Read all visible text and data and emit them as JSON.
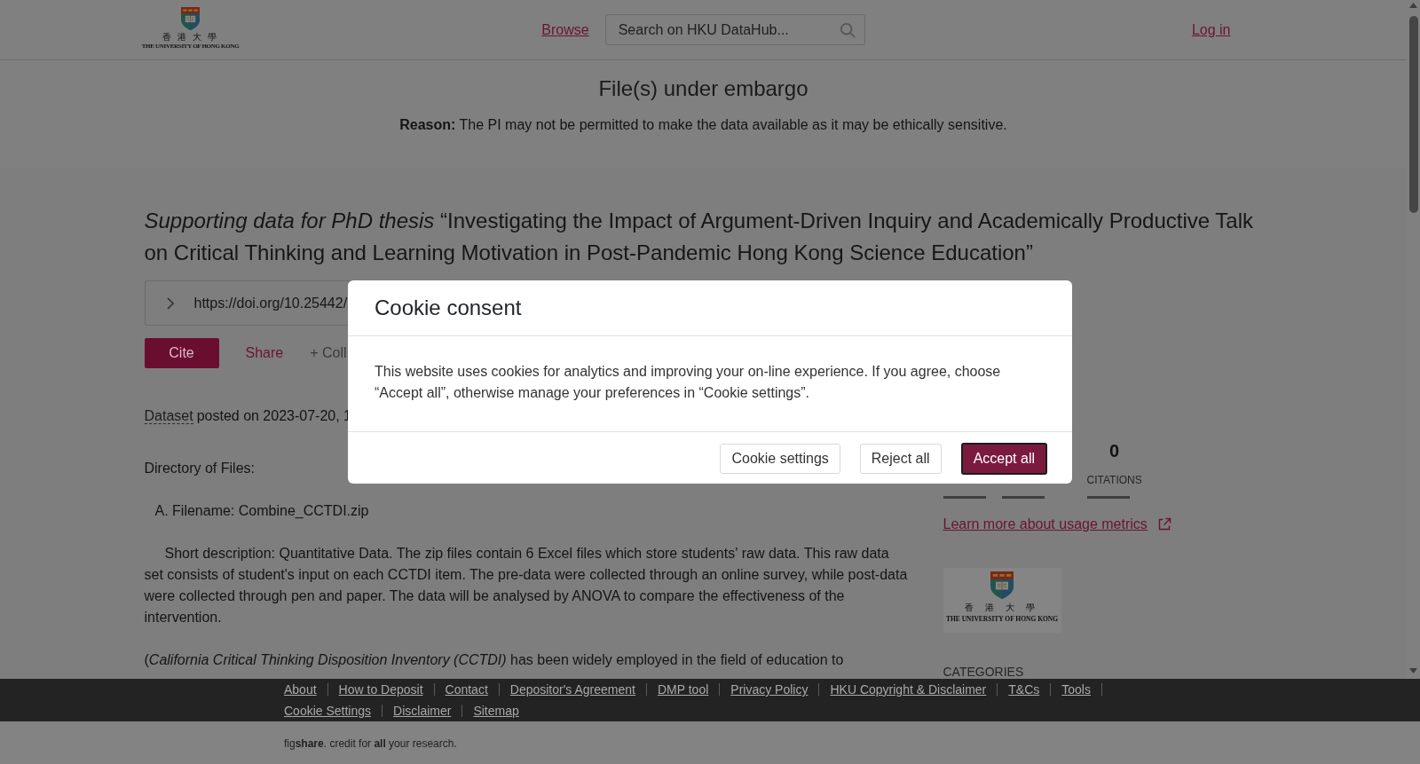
{
  "header": {
    "logo": {
      "chinese": "香 港 大 學",
      "english": "THE UNIVERSITY OF HONG KONG"
    },
    "browse_link": "Browse",
    "search": {
      "placeholder": "Search on HKU DataHub..."
    },
    "login_link": "Log in"
  },
  "embargo": {
    "title": "File(s) under embargo",
    "reason": "**Reason:** The PI may not be permitted to make the data available as it may be ethically sensitive."
  },
  "dataset": {
    "title": "*Supporting data for PhD thesis* “Investigating the Impact of Argument-Driven Inquiry and Academically Productive Talk on Critical Thinking and Learning Motivation in Post-Pandemic Hong Kong Science Education”",
    "doi": "https://doi.org/10.25442/",
    "actions": [
      {
        "kind": "primary",
        "label": "Cite"
      },
      {
        "kind": "link",
        "label": "Share"
      },
      {
        "kind": "muted",
        "label": "+ Coll"
      }
    ],
    "item_type": "Dataset",
    "posted": "posted on 2023-07-20, 1",
    "description": [
      {
        "kind": "plain",
        "text": "Directory of Files:"
      },
      {
        "kind": "item",
        "text": "A. Filename: Combine_CCTDI.zip"
      },
      {
        "kind": "indented",
        "text": "Short description: Quantitative Data. The zip files contain 6 Excel files which store students' raw data. This raw data set consists of student's input on each CCTDI item. The pre-data were collected through an online survey, while post-data were collected through pen and paper. The data will be analysed by ANOVA to compare the effectiveness of the intervention."
      },
      {
        "kind": "plain",
        "text": "(*California Critical Thinking Disposition Inventory (CCTDI)* has been widely employed in the field of education to"
      }
    ]
  },
  "metrics": {
    "stats": [
      {
        "value": "0",
        "label": "CITATIONS"
      }
    ],
    "learn_more_link": "Learn more about usage metrics"
  },
  "institution_logo": {
    "chinese": "香 港 大 學",
    "english": "THE UNIVERSITY OF HONG KONG"
  },
  "categories_heading": "CATEGORIES",
  "footer": {
    "links": [
      "About",
      "How to Deposit",
      "Contact",
      "Depositor's Agreement",
      "DMP tool",
      "Privacy Policy",
      "HKU Copyright & Disclaimer",
      "T&Cs",
      "Tools",
      "Cookie Settings",
      "Disclaimer",
      "Sitemap"
    ],
    "credit": "fig**share**. credit for **all** your research."
  },
  "cookie_dialog": {
    "title": "Cookie consent",
    "message": "This website uses cookies for analytics and improving your on-line experience. If you agree, choose “Accept all”, otherwise manage your preferences in “Cookie settings”.",
    "buttons": [
      {
        "kind": "outline",
        "label": "Cookie settings",
        "focused": false
      },
      {
        "kind": "outline",
        "label": "Reject all",
        "focused": false
      },
      {
        "kind": "primary",
        "label": "Accept all",
        "focused": true
      }
    ]
  }
}
